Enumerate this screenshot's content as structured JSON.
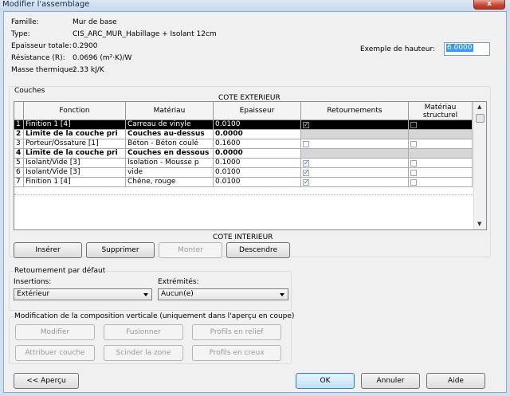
{
  "window": {
    "title": "Modifier l'assemblage",
    "close_glyph": "x"
  },
  "properties": [
    {
      "label": "Famille:",
      "value": "Mur de base"
    },
    {
      "label": "Type:",
      "value": "CIS_ARC_MUR_Habillage + Isolant 12cm"
    },
    {
      "label": "Epaisseur totale:",
      "value": "0.2900"
    },
    {
      "label": "Résistance (R):",
      "value": "0.0696 (m²·K)/W"
    },
    {
      "label": "Masse thermique:",
      "value": "2.33 kJ/K"
    }
  ],
  "sample_height": {
    "label": "Exemple de hauteur:",
    "value": "6.0000"
  },
  "layers": {
    "group_title": "Couches",
    "exterior_label": "COTE EXTERIEUR",
    "interior_label": "COTE INTERIEUR",
    "columns": [
      "Fonction",
      "Matériau",
      "Epaisseur",
      "Retournements",
      "Matériau structurel"
    ],
    "rows": [
      {
        "num": "1",
        "function": "Finition 1 [4]",
        "material": "Carreau de vinyle",
        "thickness": "0.0100",
        "wraps": true,
        "structural": false,
        "kind": "selected"
      },
      {
        "num": "2",
        "function": "Limite de la couche pri",
        "material": "Couches au-dessus",
        "thickness": "0.0000",
        "wraps": null,
        "structural": null,
        "kind": "boundary"
      },
      {
        "num": "3",
        "function": "Porteur/Ossature [1]",
        "material": "Béton - Béton coulé",
        "thickness": "0.1600",
        "wraps": false,
        "structural": false,
        "kind": "normal"
      },
      {
        "num": "4",
        "function": "Limite de la couche pri",
        "material": "Couches en dessous",
        "thickness": "0.0000",
        "wraps": null,
        "structural": null,
        "kind": "boundary"
      },
      {
        "num": "5",
        "function": "Isolant/Vide [3]",
        "material": "Isolation - Mousse p",
        "thickness": "0.1000",
        "wraps": true,
        "structural": false,
        "kind": "normal"
      },
      {
        "num": "6",
        "function": "Isolant/Vide [3]",
        "material": "vide",
        "thickness": "0.0100",
        "wraps": true,
        "structural": false,
        "kind": "normal"
      },
      {
        "num": "7",
        "function": "Finition 1 [4]",
        "material": "Chêne, rouge",
        "thickness": "0.0100",
        "wraps": true,
        "structural": false,
        "kind": "normal"
      }
    ],
    "buttons": {
      "insert": "Insérer",
      "delete": "Supprimer",
      "up": "Monter",
      "down": "Descendre"
    }
  },
  "default_wrapping": {
    "group_title": "Retournement par défaut",
    "inserts_label": "Insertions:",
    "inserts_value": "Extérieur",
    "ends_label": "Extrémités:",
    "ends_value": "Aucun(e)"
  },
  "vertical_structure": {
    "group_title": "Modification de la composition verticale (uniquement dans l'aperçu en coupe)",
    "buttons": {
      "modify": "Modifier",
      "merge": "Fusionner",
      "sweeps": "Profils en relief",
      "assign": "Attribuer couche",
      "split": "Scinder la zone",
      "reveals": "Profils en creux"
    }
  },
  "footer": {
    "preview": "<< Aperçu",
    "ok": "OK",
    "cancel": "Annuler",
    "help": "Aide"
  },
  "icons": {
    "scroll_up": "scroll-up-arrow-icon",
    "scroll_down": "scroll-down-arrow-icon",
    "combo": "chevron-down-icon",
    "checkbox": "checkmark-icon"
  },
  "colors": {
    "selection": "#000000",
    "highlight": "#3399ff",
    "boundary_row": "#d6d6d6"
  }
}
